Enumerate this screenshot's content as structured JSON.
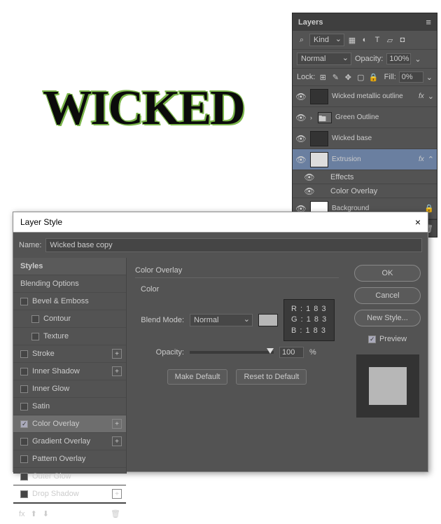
{
  "canvas": {
    "text": "WICKED"
  },
  "layers": {
    "title": "Layers",
    "filter_label": "Kind",
    "blend_mode": "Normal",
    "opacity_label": "Opacity:",
    "opacity_value": "100%",
    "lock_label": "Lock:",
    "fill_label": "Fill:",
    "fill_value": "0%",
    "items": [
      {
        "name": "Wicked metallic outline",
        "fx": true
      },
      {
        "name": "Green Outline",
        "folder": true
      },
      {
        "name": "Wicked base"
      },
      {
        "name": "Extrusion",
        "fx": true,
        "selected": true,
        "expanded": true
      },
      {
        "name": "Background",
        "locked": true
      }
    ],
    "effects_label": "Effects",
    "effect_item": "Color Overlay"
  },
  "dialog": {
    "title": "Layer Style",
    "name_label": "Name:",
    "name_value": "Wicked base copy",
    "styles_header": "Styles",
    "blending_options": "Blending Options",
    "style_list": [
      {
        "label": "Bevel & Emboss",
        "plus": false
      },
      {
        "label": "Contour",
        "indent": true
      },
      {
        "label": "Texture",
        "indent": true
      },
      {
        "label": "Stroke",
        "plus": true
      },
      {
        "label": "Inner Shadow",
        "plus": true
      },
      {
        "label": "Inner Glow"
      },
      {
        "label": "Satin"
      },
      {
        "label": "Color Overlay",
        "checked": true,
        "selected": true,
        "plus": true
      },
      {
        "label": "Gradient Overlay",
        "plus": true
      },
      {
        "label": "Pattern Overlay"
      },
      {
        "label": "Outer Glow"
      },
      {
        "label": "Drop Shadow",
        "plus": true
      }
    ],
    "section_title": "Color Overlay",
    "color_label": "Color",
    "blend_mode_label": "Blend Mode:",
    "blend_mode_value": "Normal",
    "opacity_label": "Opacity:",
    "opacity_value": "100",
    "opacity_unit": "%",
    "make_default": "Make Default",
    "reset_default": "Reset to Default",
    "rgb": {
      "r": "R : 1 8 3",
      "g": "G : 1 8 3",
      "b": "B : 1 8 3"
    },
    "ok": "OK",
    "cancel": "Cancel",
    "new_style": "New Style...",
    "preview": "Preview"
  }
}
